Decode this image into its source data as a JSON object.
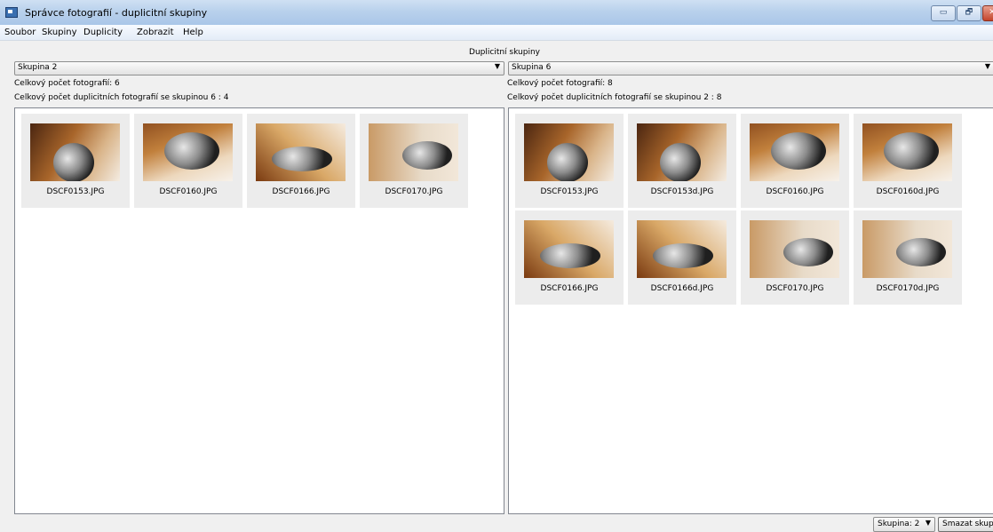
{
  "window": {
    "title": "Správce fotografií - duplicitní skupiny",
    "min_glyph": "▭",
    "max_glyph": "🗗",
    "close_glyph": "✕"
  },
  "menu": {
    "items": [
      "Soubor",
      "Skupiny",
      "Duplicity",
      "Zobrazit",
      "Help"
    ]
  },
  "section_title": "Duplicitní skupiny",
  "left": {
    "selected_group": "Skupina 2",
    "total_label": "Celkový počet fotografií: 6",
    "dup_label": "Celkový počet duplicitních fotografií se skupinou 6 : 4",
    "photos": [
      "DSCF0153.JPG",
      "DSCF0160.JPG",
      "DSCF0166.JPG",
      "DSCF0170.JPG"
    ]
  },
  "right": {
    "selected_group": "Skupina 6",
    "total_label": "Celkový počet fotografií: 8",
    "dup_label": "Celkový počet duplicitních fotografií se skupinou 2 : 8",
    "photos": [
      "DSCF0153.JPG",
      "DSCF0153d.JPG",
      "DSCF0160.JPG",
      "DSCF0160d.JPG",
      "DSCF0166.JPG",
      "DSCF0166d.JPG",
      "DSCF0170.JPG",
      "DSCF0170d.JPG"
    ]
  },
  "bottom": {
    "group_select": "Skupina: 2",
    "delete_label": "Smazat skupinu"
  },
  "icons": {
    "dropdown": "▼"
  },
  "colors": {
    "titlebar": "#b9d1ec",
    "window_bg": "#f0f0f0",
    "thumb_bg": "#ececec",
    "close_button": "#c4442b"
  }
}
